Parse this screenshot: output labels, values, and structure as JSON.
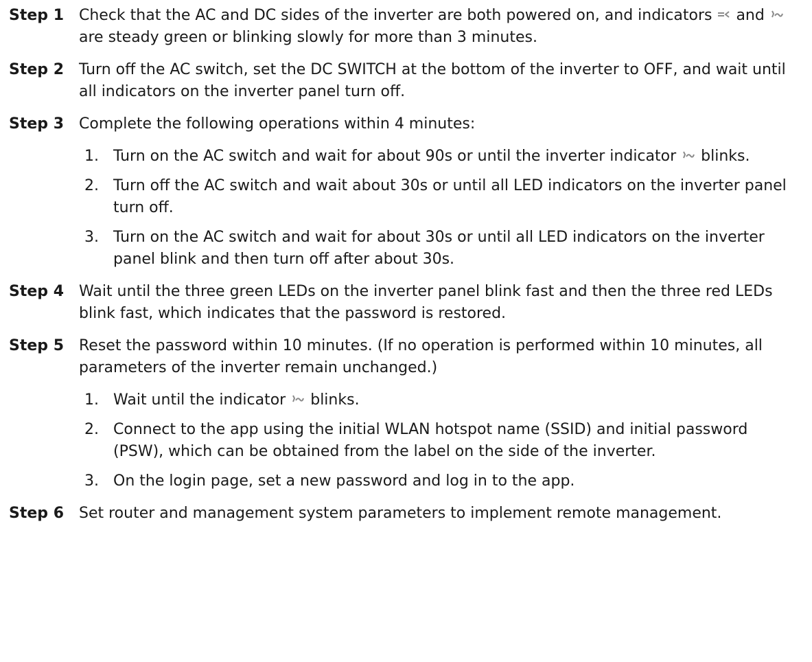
{
  "steps": [
    {
      "label": "Step 1",
      "text_before": "Check that the AC and DC sides of the inverter are both powered on, and indicators",
      "text_mid": "and",
      "text_after": "are steady green or blinking slowly for more than 3 minutes."
    },
    {
      "label": "Step 2",
      "text": "Turn off the AC switch, set the DC SWITCH at the bottom of the inverter to OFF, and wait until all indicators on the inverter panel turn off."
    },
    {
      "label": "Step 3",
      "text": "Complete the following operations within 4 minutes:",
      "substeps": [
        {
          "num": "1.",
          "text_before": "Turn on the AC switch and wait for about 90s or until the inverter indicator",
          "text_after": "blinks."
        },
        {
          "num": "2.",
          "text": "Turn off the AC switch and wait about 30s or until all LED indicators on the inverter panel turn off."
        },
        {
          "num": "3.",
          "text": "Turn on the AC switch and wait for about 30s or until all LED indicators on the inverter panel blink and then turn off after about 30s."
        }
      ]
    },
    {
      "label": "Step 4",
      "text": "Wait until the three green LEDs on the inverter panel blink fast and then the three red LEDs blink fast, which indicates that the password is restored."
    },
    {
      "label": "Step 5",
      "text": "Reset the password within 10 minutes. (If no operation is performed within 10 minutes, all parameters of the inverter remain unchanged.)",
      "substeps": [
        {
          "num": "1.",
          "text_before": "Wait until the indicator",
          "text_after": "blinks."
        },
        {
          "num": "2.",
          "text": "Connect to the app using the initial WLAN hotspot name (SSID) and initial password (PSW), which can be obtained from the label on the side of the inverter."
        },
        {
          "num": "3.",
          "text": "On the login page, set a new password and log in to the app."
        }
      ]
    },
    {
      "label": "Step 6",
      "text": "Set router and management system parameters to implement remote management."
    }
  ],
  "icons": {
    "pv_indicator": "pv-indicator-icon",
    "grid_indicator": "grid-indicator-icon"
  }
}
